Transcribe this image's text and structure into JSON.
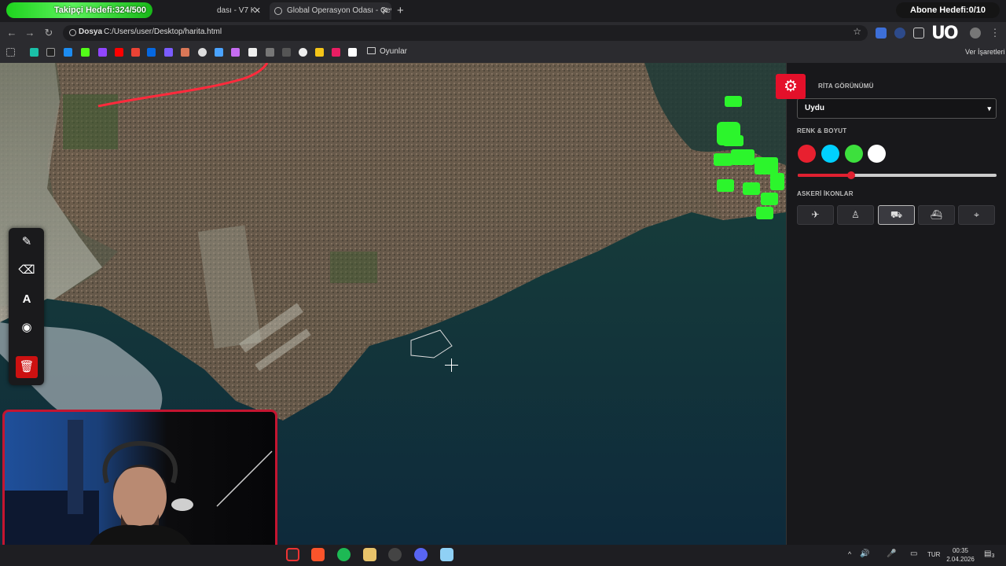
{
  "overlay": {
    "follower_goal": "Takipçi Hedefi:324/500",
    "subscriber_goal": "Abone Hedefi:0/10"
  },
  "browser": {
    "tabs": [
      {
        "title": "dası - V7 K"
      },
      {
        "title": "Global Operasyon Odası - Çev"
      }
    ],
    "new_tab": "+",
    "address": {
      "scheme_label": "Dosya",
      "url": "C:/Users/user/Desktop/harita.html"
    },
    "bookmarks": {
      "folder": "Oyunlar",
      "right_label": "Ver İşaretleri"
    }
  },
  "map": {
    "view_label": "RİTA GÖRÜNÜMÜ",
    "view_selected": "Uydu",
    "color_size_label": "RENK & BOYUT",
    "colors": [
      "#e8202f",
      "#00d0ff",
      "#3de03d",
      "#ffffff"
    ],
    "size_level": 0.27,
    "icons_label": "ASKERİ İKONLAR",
    "military_icons": [
      "plane-icon",
      "soldier-icon",
      "tank-icon",
      "ship-icon",
      "target-icon"
    ],
    "active_icon": "tank-icon",
    "accent_color": "#e4102a",
    "route_color": "#ff2a3c",
    "unit_color": "#2cf52c"
  },
  "toolbar": {
    "text_tool_glyph": "A"
  },
  "taskbar": {
    "language": "TUR",
    "time": "00:35",
    "date": "2.04.2026",
    "notifications": "3"
  }
}
